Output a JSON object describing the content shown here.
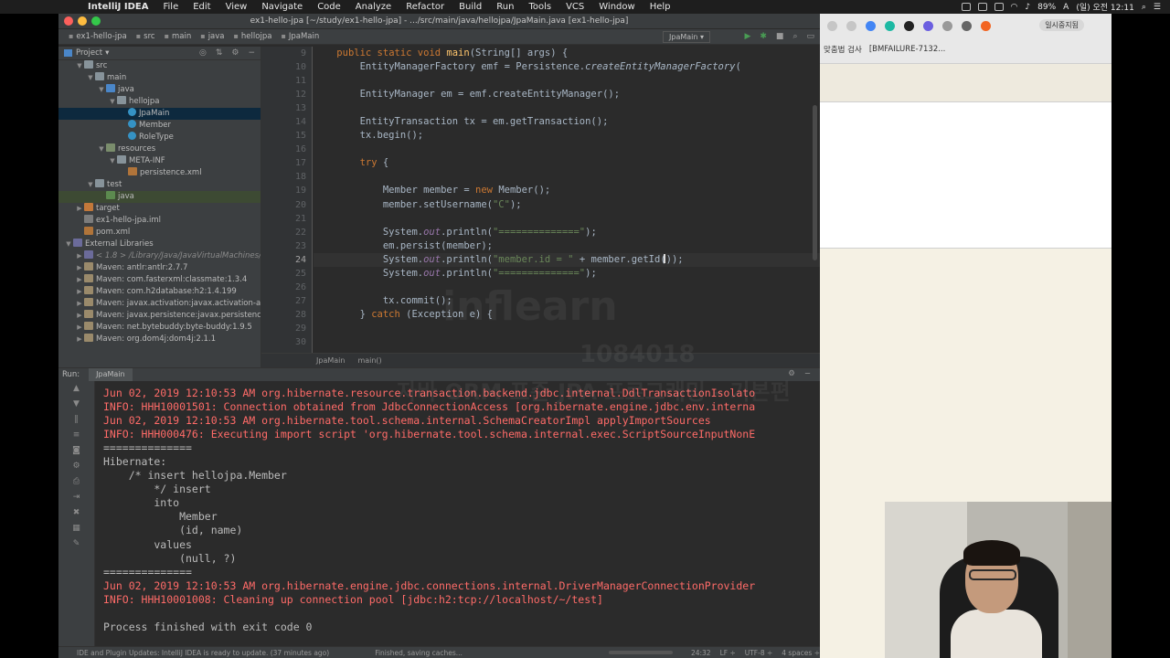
{
  "menubar": {
    "app": "IntelliJ IDEA",
    "items": [
      "File",
      "Edit",
      "View",
      "Navigate",
      "Code",
      "Analyze",
      "Refactor",
      "Build",
      "Run",
      "Tools",
      "VCS",
      "Window",
      "Help"
    ],
    "battery": "89%",
    "clock": "(일) 오전 12:11"
  },
  "window": {
    "title": "ex1-hello-jpa [~/study/ex1-hello-jpa] - .../src/main/java/hellojpa/JpaMain.java [ex1-hello-jpa]"
  },
  "breadcrumb": [
    "ex1-hello-jpa",
    "src",
    "main",
    "java",
    "hellojpa",
    "JpaMain"
  ],
  "run_config": "JpaMain",
  "project": {
    "header": "Project",
    "tree": [
      {
        "label": "src",
        "indent": 1,
        "arrow": "▼",
        "icon": "folder"
      },
      {
        "label": "main",
        "indent": 2,
        "arrow": "▼",
        "icon": "folder"
      },
      {
        "label": "java",
        "indent": 3,
        "arrow": "▼",
        "icon": "src"
      },
      {
        "label": "hellojpa",
        "indent": 4,
        "arrow": "▼",
        "icon": "folder"
      },
      {
        "label": "JpaMain",
        "indent": 5,
        "arrow": "",
        "icon": "cls",
        "selected": true
      },
      {
        "label": "Member",
        "indent": 5,
        "arrow": "",
        "icon": "cls"
      },
      {
        "label": "RoleType",
        "indent": 5,
        "arrow": "",
        "icon": "cls"
      },
      {
        "label": "resources",
        "indent": 3,
        "arrow": "▼",
        "icon": "res"
      },
      {
        "label": "META-INF",
        "indent": 4,
        "arrow": "▼",
        "icon": "folder"
      },
      {
        "label": "persistence.xml",
        "indent": 5,
        "arrow": "",
        "icon": "xml"
      },
      {
        "label": "test",
        "indent": 2,
        "arrow": "▼",
        "icon": "folder"
      },
      {
        "label": "java",
        "indent": 3,
        "arrow": "",
        "icon": "test",
        "highlight": true
      },
      {
        "label": "target",
        "indent": 1,
        "arrow": "▶",
        "icon": "target"
      },
      {
        "label": "ex1-hello-jpa.iml",
        "indent": 1,
        "arrow": "",
        "icon": "iml"
      },
      {
        "label": "pom.xml",
        "indent": 1,
        "arrow": "",
        "icon": "xml"
      },
      {
        "label": "External Libraries",
        "indent": 0,
        "arrow": "▼",
        "icon": "lib"
      },
      {
        "label": "< 1.8 >  /Library/Java/JavaVirtualMachines/j",
        "indent": 1,
        "arrow": "▶",
        "icon": "lib"
      },
      {
        "label": "Maven: antlr:antlr:2.7.7",
        "indent": 1,
        "arrow": "▶",
        "icon": "jar"
      },
      {
        "label": "Maven: com.fasterxml:classmate:1.3.4",
        "indent": 1,
        "arrow": "▶",
        "icon": "jar"
      },
      {
        "label": "Maven: com.h2database:h2:1.4.199",
        "indent": 1,
        "arrow": "▶",
        "icon": "jar"
      },
      {
        "label": "Maven: javax.activation:javax.activation-ap",
        "indent": 1,
        "arrow": "▶",
        "icon": "jar"
      },
      {
        "label": "Maven: javax.persistence:javax.persistence",
        "indent": 1,
        "arrow": "▶",
        "icon": "jar"
      },
      {
        "label": "Maven: net.bytebuddy:byte-buddy:1.9.5",
        "indent": 1,
        "arrow": "▶",
        "icon": "jar"
      },
      {
        "label": "Maven: org.dom4j:dom4j:2.1.1",
        "indent": 1,
        "arrow": "▶",
        "icon": "jar"
      }
    ]
  },
  "editor": {
    "current_line": "24",
    "line_numbers": [
      "9",
      "10",
      "11",
      "12",
      "13",
      "14",
      "15",
      "16",
      "17",
      "18",
      "19",
      "20",
      "21",
      "22",
      "23",
      "24",
      "25",
      "26",
      "27",
      "28",
      "29",
      "30"
    ],
    "code": [
      [
        {
          "t": "    "
        },
        {
          "t": "public static void ",
          "c": "kw"
        },
        {
          "t": "main",
          "c": "fn"
        },
        {
          "t": "(String[] args) {"
        }
      ],
      [
        {
          "t": "        EntityManagerFactory emf = Persistence."
        },
        {
          "t": "createEntityManagerFactory",
          "c": "itf"
        },
        {
          "t": "("
        }
      ],
      [
        {
          "t": ""
        }
      ],
      [
        {
          "t": "        EntityManager em = emf.createEntityManager();"
        }
      ],
      [
        {
          "t": ""
        }
      ],
      [
        {
          "t": "        EntityTransaction tx = em.getTransaction();"
        }
      ],
      [
        {
          "t": "        tx.begin();"
        }
      ],
      [
        {
          "t": ""
        }
      ],
      [
        {
          "t": "        "
        },
        {
          "t": "try",
          "c": "kw"
        },
        {
          "t": " {"
        }
      ],
      [
        {
          "t": ""
        }
      ],
      [
        {
          "t": "            Member member = "
        },
        {
          "t": "new ",
          "c": "kw"
        },
        {
          "t": "Member();"
        }
      ],
      [
        {
          "t": "            member.setUsername("
        },
        {
          "t": "\"C\"",
          "c": "st"
        },
        {
          "t": ");"
        }
      ],
      [
        {
          "t": ""
        }
      ],
      [
        {
          "t": "            System."
        },
        {
          "t": "out",
          "c": "it"
        },
        {
          "t": ".println("
        },
        {
          "t": "\"==============\"",
          "c": "st"
        },
        {
          "t": ");"
        }
      ],
      [
        {
          "t": "            em.persist(member);"
        }
      ],
      [
        {
          "t": "            System."
        },
        {
          "t": "out",
          "c": "it"
        },
        {
          "t": ".println("
        },
        {
          "t": "\"member.id = \"",
          "c": "st"
        },
        {
          "t": " + member.getId());"
        }
      ],
      [
        {
          "t": "            System."
        },
        {
          "t": "out",
          "c": "it"
        },
        {
          "t": ".println("
        },
        {
          "t": "\"==============\"",
          "c": "st"
        },
        {
          "t": ");"
        }
      ],
      [
        {
          "t": ""
        }
      ],
      [
        {
          "t": "            tx.commit();"
        }
      ],
      [
        {
          "t": "        } "
        },
        {
          "t": "catch",
          "c": "kw"
        },
        {
          "t": " (Exception e) {"
        }
      ],
      [
        {
          "t": ""
        }
      ],
      [
        {
          "t": ""
        }
      ]
    ],
    "breadcrumb": [
      "JpaMain",
      "main()"
    ]
  },
  "run": {
    "label": "Run:",
    "tab": "JpaMain",
    "console": [
      {
        "text": "Jun 02, 2019 12:10:53 AM org.hibernate.resource.transaction.backend.jdbc.internal.DdlTransactionIsolato",
        "err": true
      },
      {
        "text": "INFO: HHH10001501: Connection obtained from JdbcConnectionAccess [org.hibernate.engine.jdbc.env.interna",
        "err": true
      },
      {
        "text": "Jun 02, 2019 12:10:53 AM org.hibernate.tool.schema.internal.SchemaCreatorImpl applyImportSources",
        "err": true
      },
      {
        "text": "INFO: HHH000476: Executing import script 'org.hibernate.tool.schema.internal.exec.ScriptSourceInputNonE",
        "err": true
      },
      {
        "text": "==============",
        "err": false
      },
      {
        "text": "Hibernate:",
        "err": false
      },
      {
        "text": "    /* insert hellojpa.Member",
        "err": false
      },
      {
        "text": "        */ insert",
        "err": false
      },
      {
        "text": "        into",
        "err": false
      },
      {
        "text": "            Member",
        "err": false
      },
      {
        "text": "            (id, name)",
        "err": false
      },
      {
        "text": "        values",
        "err": false
      },
      {
        "text": "            (null, ?)",
        "err": false
      },
      {
        "text": "==============",
        "err": false
      },
      {
        "text": "Jun 02, 2019 12:10:53 AM org.hibernate.engine.jdbc.connections.internal.DriverManagerConnectionProvider",
        "err": true
      },
      {
        "text": "INFO: HHH10001008: Cleaning up connection pool [jdbc:h2:tcp://localhost/~/test]",
        "err": true
      },
      {
        "text": "",
        "err": false
      },
      {
        "text": "Process finished with exit code 0",
        "err": false
      }
    ]
  },
  "status": {
    "message": "IDE and Plugin Updates: IntelliJ IDEA is ready to update. (37 minutes ago)",
    "progress": "Finished, saving caches...",
    "position": "24:32",
    "line_sep": "LF ÷",
    "encoding": "UTF-8 ÷",
    "indent": "4 spaces ÷"
  },
  "browser": {
    "tab_badge": "일시중지됨",
    "bookmarks": [
      "맞춤법 검사",
      "[BMFAILURE-7132..."
    ]
  }
}
